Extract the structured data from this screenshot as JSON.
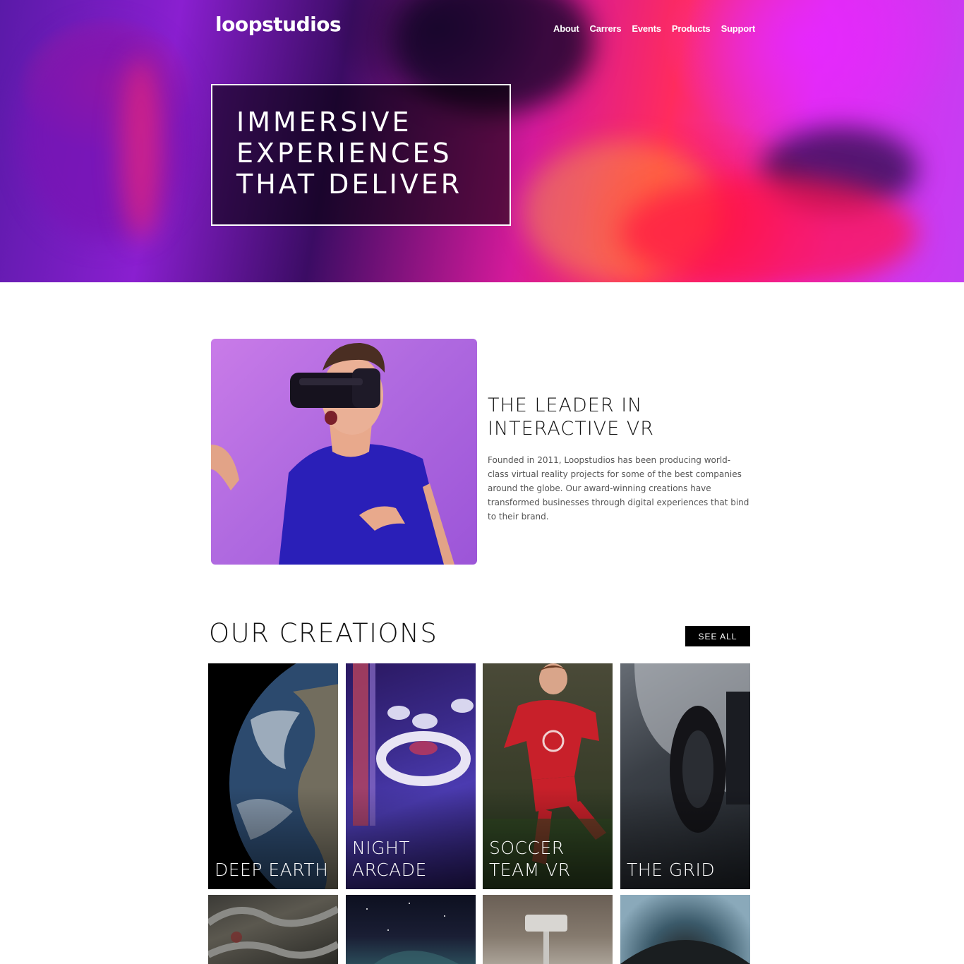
{
  "brand": {
    "logo_text": "loopstudios"
  },
  "nav": {
    "items": [
      {
        "label": "About"
      },
      {
        "label": "Carrers"
      },
      {
        "label": "Events"
      },
      {
        "label": "Products"
      },
      {
        "label": "Support"
      }
    ]
  },
  "hero": {
    "title_lines": [
      "IMMERSIVE",
      "EXPERIENCES",
      "THAT DELIVER"
    ]
  },
  "intro": {
    "title_lines": [
      "THE LEADER IN",
      "INTERACTIVE VR"
    ],
    "text": "Founded in 2011, Loopstudios has been producing world-class virtual reality projects for some of the best companies around the globe. Our award-winning creations have transformed businesses through digital experiences that bind to their brand."
  },
  "creations": {
    "title": "OUR CREATIONS",
    "see_all_label": "SEE ALL",
    "cards": [
      {
        "lines": [
          "DEEP EARTH"
        ]
      },
      {
        "lines": [
          "NIGHT",
          "ARCADE"
        ]
      },
      {
        "lines": [
          "SOCCER",
          "TEAM VR"
        ]
      },
      {
        "lines": [
          "THE GRID"
        ]
      },
      {
        "lines": []
      },
      {
        "lines": []
      },
      {
        "lines": []
      },
      {
        "lines": []
      }
    ]
  },
  "colors": {
    "accent": "#000000",
    "hero_magenta": "#e02cf0",
    "hero_red": "#ff2b5e",
    "intro_purple": "#b06ae0"
  }
}
